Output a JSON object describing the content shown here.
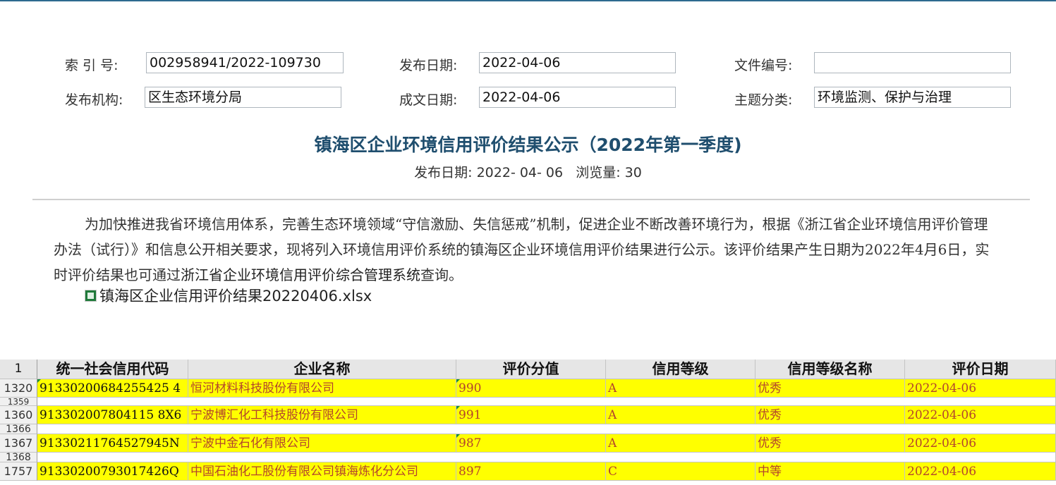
{
  "meta": {
    "index_label": "索 引 号:",
    "index_value": "002958941/2022-109730",
    "publish_date_label": "发布日期:",
    "publish_date_value": "2022-04-06",
    "file_no_label": "文件编号:",
    "file_no_value": "",
    "org_label": "发布机构:",
    "org_value": "区生态环境分局",
    "written_date_label": "成文日期:",
    "written_date_value": "2022-04-06",
    "topic_label": "主题分类:",
    "topic_value": "环境监测、保护与治理"
  },
  "article": {
    "title": "镇海区企业环境信用评价结果公示（2022年第一季度)",
    "publish_label": "发布日期:",
    "publish_date": "2022- 04- 06",
    "views_label": "浏览量:",
    "views": "30",
    "paragraph_part1": "为加快推进我省环境信用体系，完善生态环境领域“守信激励、失信惩戒”机制，促进企业不断改善环境行为，根据《浙江省企业环境信用评价管理办法（试行）》和信息公开相关要求，现将列入环境信用评价系统的镇海区企业环境信用评价结果进行公示。该评价结果产生日期为2022年4月6日，实时评价结果也可通过",
    "paragraph_system": "浙江省企业环境信用评价综合管理系统",
    "paragraph_part2": "查询。",
    "attachment": "镇海区企业信用评价结果20220406.xlsx"
  },
  "sheet": {
    "header_row_num": "1",
    "headers": [
      "统一社会信用代码",
      "企业名称",
      "评价分值",
      "信用等级",
      "信用等级名称",
      "评价日期"
    ],
    "rows": [
      {
        "num": "1320",
        "cells": [
          "91330200684255425 4",
          "恒河材料科技股份有限公司",
          "990",
          "A",
          "优秀",
          "2022-04-06"
        ]
      },
      {
        "num": "1359",
        "cells": []
      },
      {
        "num": "1360",
        "cells": [
          "913302007804115 8X6",
          "宁波博汇化工科技股份有限公司",
          "991",
          "A",
          "优秀",
          "2022-04-06"
        ]
      },
      {
        "num": "1366",
        "cells": []
      },
      {
        "num": "1367",
        "cells": [
          "91330211764527945N",
          "宁波中金石化有限公司",
          "987",
          "A",
          "优秀",
          "2022-04-06"
        ]
      },
      {
        "num": "1368",
        "cells": []
      },
      {
        "num": "1757",
        "cells": [
          "91330200793017426Q",
          "中国石油化工股份有限公司镇海炼化分公司",
          "897",
          "C",
          "中等",
          "2022-04-06"
        ]
      }
    ]
  },
  "colors": {
    "highlight": "#ffff00",
    "title": "#1f4e6e",
    "accent_line": "#2d6a8f"
  }
}
